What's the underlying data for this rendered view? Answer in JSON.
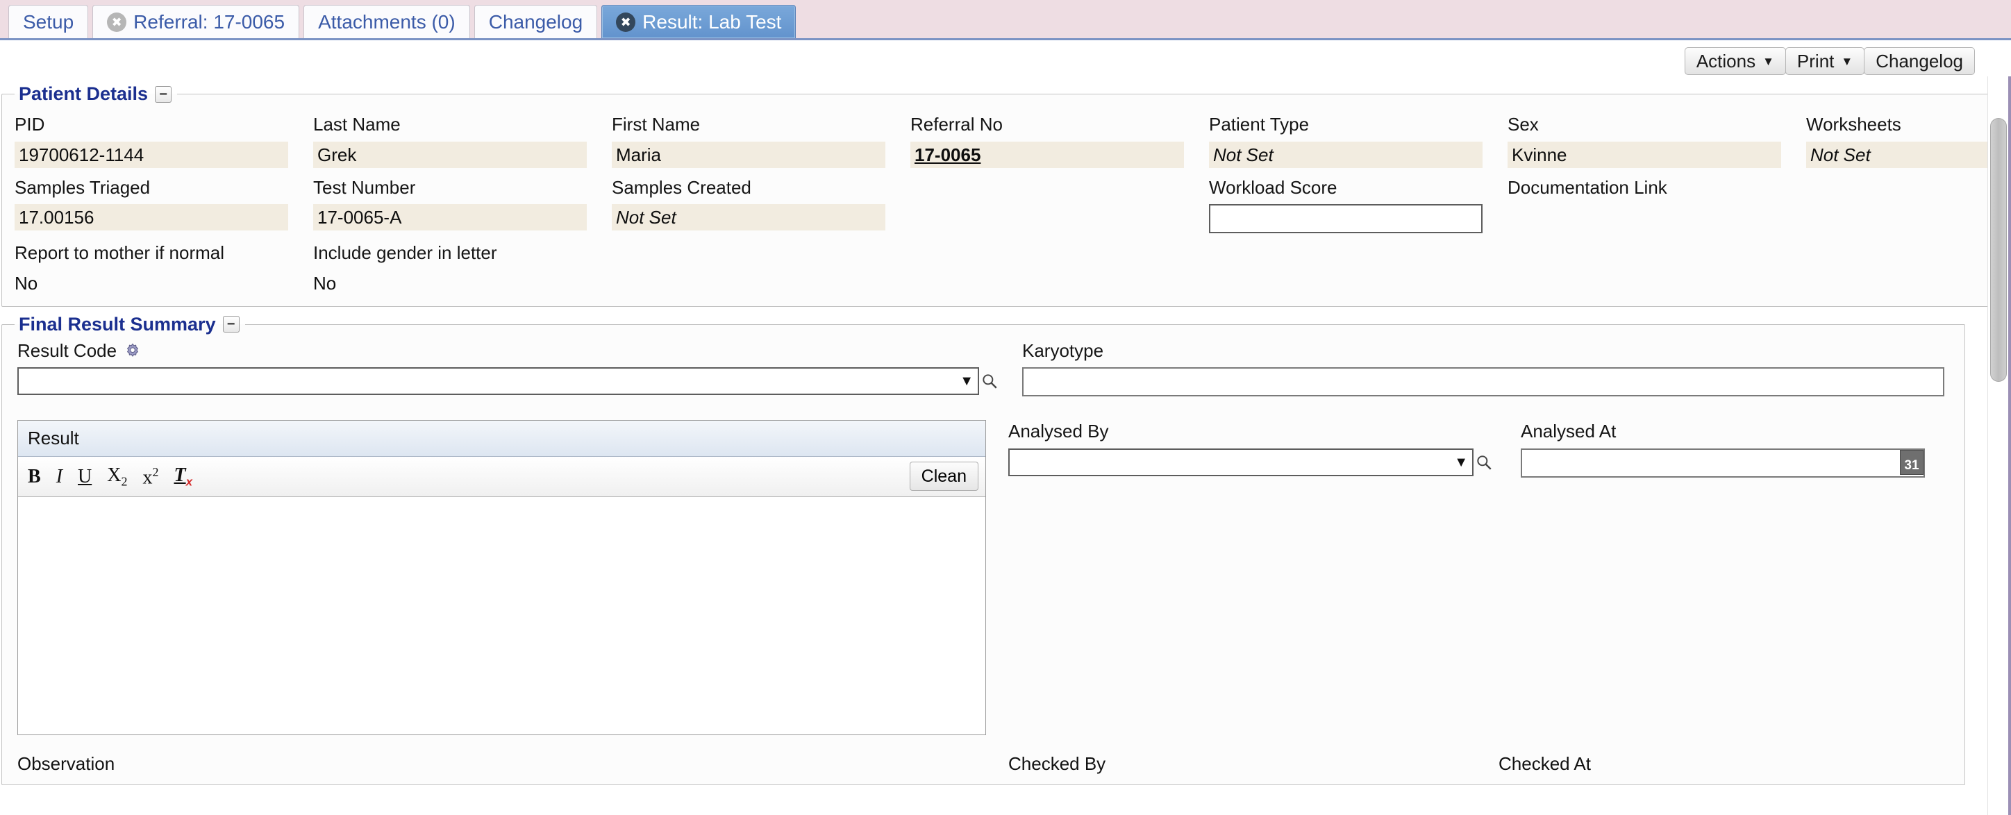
{
  "tabs": [
    {
      "label": "Setup",
      "closable": false,
      "active": false
    },
    {
      "label": "Referral: 17-0065",
      "closable": true,
      "active": false
    },
    {
      "label": "Attachments (0)",
      "closable": false,
      "active": false
    },
    {
      "label": "Changelog",
      "closable": false,
      "active": false
    },
    {
      "label": "Result: Lab Test",
      "closable": true,
      "active": true
    }
  ],
  "toolbar": {
    "actions_label": "Actions",
    "print_label": "Print",
    "changelog_label": "Changelog",
    "caret": "▼"
  },
  "patient_details": {
    "title": "Patient Details",
    "collapse_glyph": "−",
    "row1": [
      {
        "label": "PID",
        "value": "19700612-1144",
        "style": "filled"
      },
      {
        "label": "Last Name",
        "value": "Grek",
        "style": "filled"
      },
      {
        "label": "First Name",
        "value": "Maria",
        "style": "filled"
      },
      {
        "label": "Referral No",
        "value": "17-0065",
        "style": "link"
      },
      {
        "label": "Patient Type",
        "value": "Not Set",
        "style": "notset"
      },
      {
        "label": "Sex",
        "value": "Kvinne",
        "style": "filled"
      },
      {
        "label": "Worksheets",
        "value": "Not Set",
        "style": "notset"
      }
    ],
    "row2": [
      {
        "label": "Samples Triaged",
        "value": "17.00156",
        "style": "filled"
      },
      {
        "label": "Test Number",
        "value": "17-0065-A",
        "style": "filled"
      },
      {
        "label": "Samples Created",
        "value": "Not Set",
        "style": "notset"
      }
    ],
    "workload_score": {
      "label": "Workload Score",
      "value": ""
    },
    "documentation_link": {
      "label": "Documentation Link",
      "value": ""
    },
    "row3": [
      {
        "label": "Report to mother if normal",
        "value": "No"
      },
      {
        "label": "Include gender in letter",
        "value": "No"
      }
    ]
  },
  "final_result_summary": {
    "title": "Final Result Summary",
    "collapse_glyph": "−",
    "result_code": {
      "label": "Result Code",
      "value": "",
      "caret": "▼"
    },
    "karyotype": {
      "label": "Karyotype",
      "value": ""
    },
    "editor": {
      "title": "Result",
      "clean_label": "Clean",
      "tools": [
        {
          "name": "bold",
          "glyph": "B"
        },
        {
          "name": "italic",
          "glyph": "I"
        },
        {
          "name": "underline",
          "glyph": "U"
        },
        {
          "name": "subscript",
          "glyph": "X"
        },
        {
          "name": "superscript",
          "glyph": "x"
        },
        {
          "name": "remove-format",
          "glyph": "T"
        }
      ],
      "content": ""
    },
    "analysed_by": {
      "label": "Analysed By",
      "value": "",
      "caret": "▼"
    },
    "analysed_at": {
      "label": "Analysed At",
      "value": "",
      "calendar_glyph": "31"
    },
    "observation_label": "Observation",
    "checked_by_label": "Checked By",
    "checked_at_label": "Checked At"
  },
  "colors": {
    "tab_bar_bg": "#eedde3",
    "active_tab": "#6293cd",
    "legend_text": "#1b2f8f",
    "field_value_bg": "#f2ece0",
    "accent_border": "#7b93c4"
  }
}
